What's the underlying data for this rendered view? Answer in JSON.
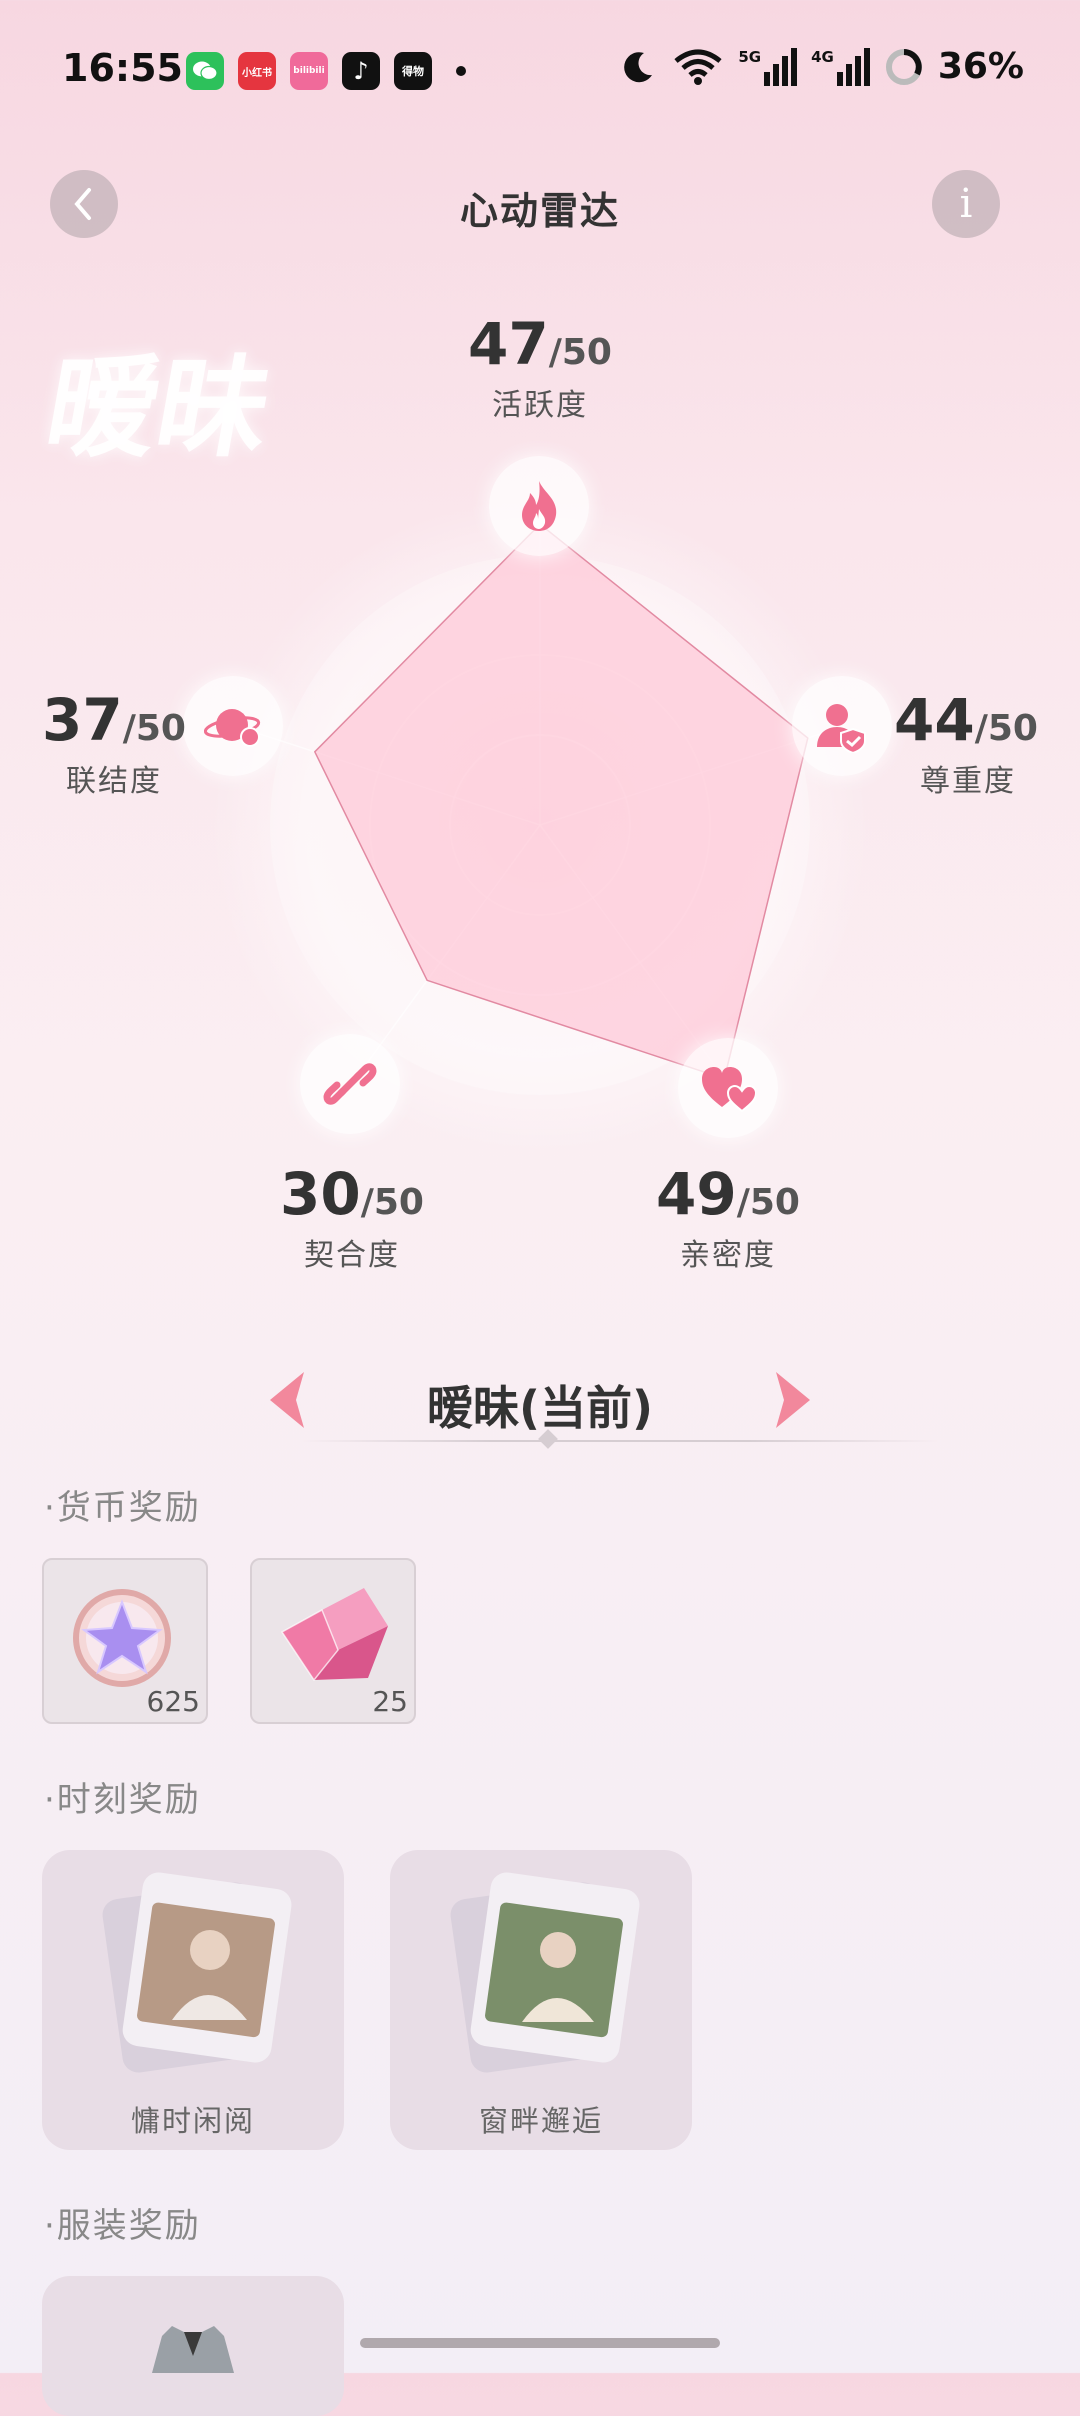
{
  "status_bar": {
    "time": "16:55",
    "apps": [
      {
        "name": "wechat-icon",
        "label": "",
        "color": "#2dc15b"
      },
      {
        "name": "xiaohongshu-icon",
        "label": "小红书",
        "color": "#e5353f"
      },
      {
        "name": "bilibili-icon",
        "label": "bilibili",
        "color": "#f06a9a"
      },
      {
        "name": "douyin-icon",
        "label": "♪",
        "color": "#111111"
      },
      {
        "name": "dewu-icon",
        "label": "得物",
        "color": "#111111"
      }
    ],
    "network_5g": "5G",
    "network_4g": "4G",
    "battery": "36%"
  },
  "header": {
    "title": "心动雷达",
    "back_icon": "chevron-left-icon",
    "info_label": "i"
  },
  "stage_word": "暧昧",
  "stage_word_faded": "昧",
  "radar": {
    "max": 50,
    "max_label": "/50",
    "dimensions": [
      {
        "key": "activity",
        "label": "活跃度",
        "value": 47,
        "value_text": "47",
        "icon": "flame-icon"
      },
      {
        "key": "respect",
        "label": "尊重度",
        "value": 44,
        "value_text": "44",
        "icon": "user-shield-icon"
      },
      {
        "key": "intimacy",
        "label": "亲密度",
        "value": 49,
        "value_text": "49",
        "icon": "hearts-icon"
      },
      {
        "key": "compatibility",
        "label": "契合度",
        "value": 30,
        "value_text": "30",
        "icon": "link-icon"
      },
      {
        "key": "connection",
        "label": "联结度",
        "value": 37,
        "value_text": "37",
        "icon": "planet-icon"
      }
    ],
    "colors": {
      "fill": "#ffc7d6",
      "stroke": "#e28aa2",
      "accent": "#f06f8c"
    }
  },
  "stage_nav": {
    "current_label": "暧昧(当前)",
    "prev_icon": "arrow-left-icon",
    "next_icon": "arrow-right-icon"
  },
  "rewards": {
    "currency_title": "·货币奖励",
    "currency_items": [
      {
        "name": "star-coin",
        "count": "625"
      },
      {
        "name": "pink-crystal",
        "count": "25"
      }
    ],
    "moment_title": "·时刻奖励",
    "moment_items": [
      {
        "label": "慵时闲阅"
      },
      {
        "label": "窗畔邂逅"
      }
    ],
    "outfit_title": "·服装奖励"
  }
}
